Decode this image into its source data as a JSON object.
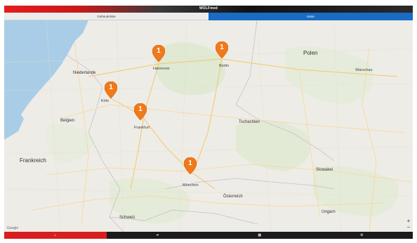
{
  "app": {
    "title": "WÜLFmed"
  },
  "tabs": [
    {
      "label": "Gebäudeliste",
      "active": false
    },
    {
      "label": "Karte",
      "active": true
    }
  ],
  "map": {
    "labels": {
      "polen": "Polen",
      "niederlande": "Niederlande",
      "belgien": "Belgien",
      "frankreich": "Frankreich",
      "tschechien": "Tschechien",
      "slowakei": "Slowakei",
      "oesterreich": "Österreich",
      "schweiz": "Schweiz",
      "ungarn": "Ungarn",
      "hannover": "Hannover",
      "berlin": "Berlin",
      "frankfurt": "Frankfurt",
      "muenchen": "München",
      "koeln": "Köln",
      "warschau": "Warschau"
    },
    "markers": [
      {
        "count": "1"
      },
      {
        "count": "1"
      },
      {
        "count": "1"
      },
      {
        "count": "1"
      },
      {
        "count": "1"
      }
    ],
    "attribution": "Google",
    "zoom_in": "+",
    "zoom_out": "−"
  },
  "bottom_nav": [
    {
      "icon": "home-icon",
      "glyph": "⌂",
      "active": true
    },
    {
      "icon": "login-icon",
      "glyph": "➔",
      "active": false
    },
    {
      "icon": "grid-icon",
      "glyph": "▦",
      "active": false
    },
    {
      "icon": "gear-icon",
      "glyph": "⚙",
      "active": false
    }
  ],
  "colors": {
    "accent_red": "#d81f1f",
    "tab_blue": "#1a6bc4",
    "marker_orange": "#f07a1a"
  }
}
